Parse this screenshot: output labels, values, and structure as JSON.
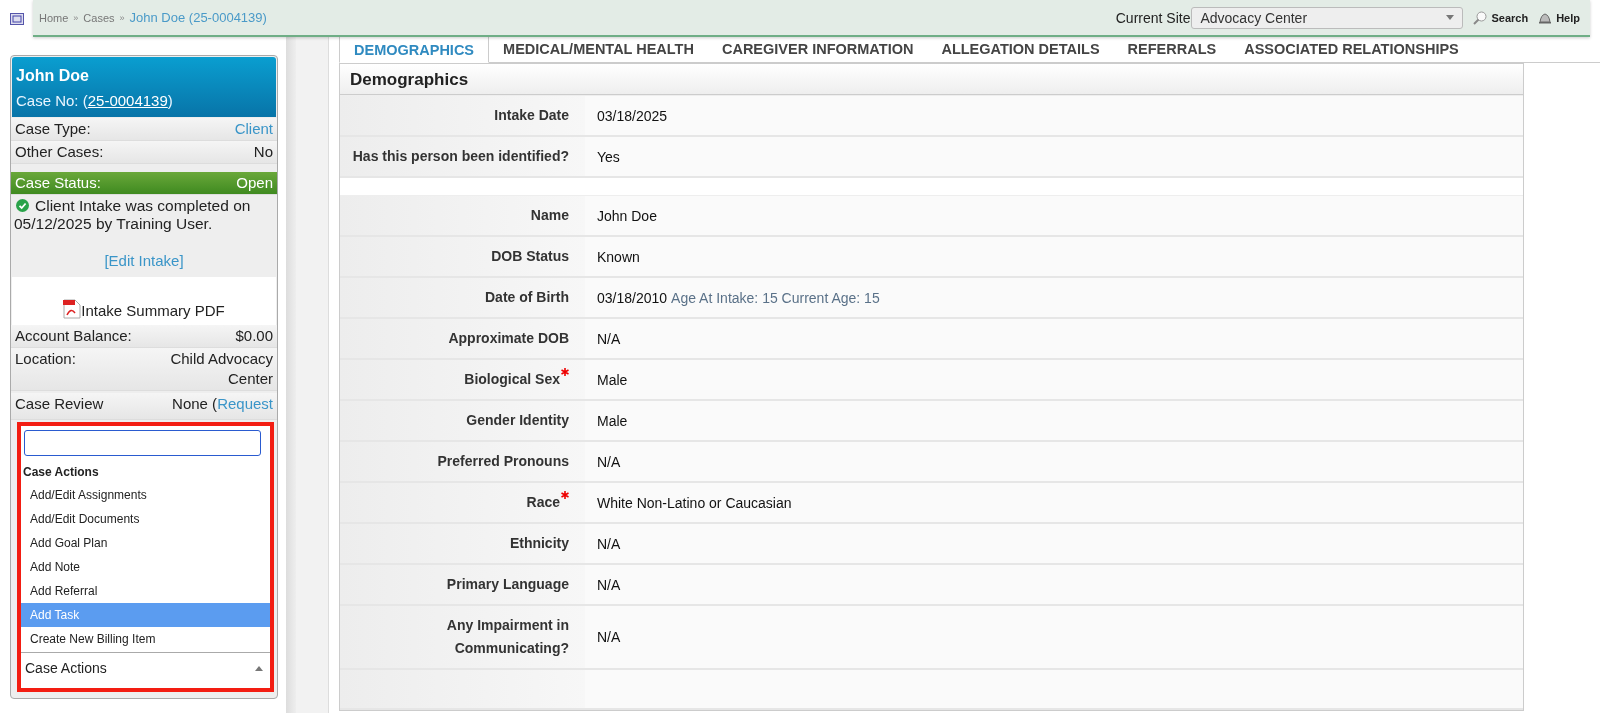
{
  "topbar": {
    "breadcrumbs": [
      {
        "label": "Home",
        "current": false
      },
      {
        "label": "Cases",
        "current": false
      },
      {
        "label": "John Doe (25-0004139)",
        "current": true
      }
    ],
    "separator": "»",
    "site_label": "Current Site",
    "site_value": "Advocacy Center",
    "search_label": "Search",
    "help_label": "Help"
  },
  "sidebar": {
    "name": "John Doe",
    "case_no_prefix": "Case No: (",
    "case_no": "25-0004139",
    "case_no_suffix": ")",
    "rows": [
      {
        "kind": "plain",
        "label": "Case Type:",
        "value": "Client",
        "link": true
      },
      {
        "kind": "plain",
        "label": "Other Cases:",
        "value": "No",
        "link": false
      },
      {
        "kind": "status",
        "label": "Case Status:",
        "value": "Open",
        "link": false
      }
    ],
    "intake_message": "Client Intake was completed on 05/12/2025 by Training User.",
    "edit_intake": "[Edit Intake]",
    "pdf_link": "Intake Summary PDF",
    "rows2": [
      {
        "label": "Account Balance:",
        "value": "$0.00"
      },
      {
        "label": "Location:",
        "value": "Child Advocacy Center"
      }
    ],
    "case_review": {
      "label": "Case Review",
      "value": "None (",
      "link": "Request"
    }
  },
  "dropdown": {
    "group": "Case Actions",
    "items": [
      {
        "label": "Add/Edit Assignments",
        "selected": false
      },
      {
        "label": "Add/Edit Documents",
        "selected": false
      },
      {
        "label": "Add Goal Plan",
        "selected": false
      },
      {
        "label": "Add Note",
        "selected": false
      },
      {
        "label": "Add Referral",
        "selected": false
      },
      {
        "label": "Add Task",
        "selected": true
      },
      {
        "label": "Create New Billing Item",
        "selected": false
      }
    ],
    "value": "Case Actions"
  },
  "tabs": [
    {
      "label": "DEMOGRAPHICS",
      "selected": true
    },
    {
      "label": "MEDICAL/MENTAL HEALTH",
      "selected": false
    },
    {
      "label": "CAREGIVER INFORMATION",
      "selected": false
    },
    {
      "label": "ALLEGATION DETAILS",
      "selected": false
    },
    {
      "label": "REFERRALS",
      "selected": false
    },
    {
      "label": "ASSOCIATED RELATIONSHIPS",
      "selected": false
    }
  ],
  "section": {
    "title": "Demographics",
    "groups": [
      [
        {
          "label": "Intake Date",
          "value": "03/18/2025",
          "required": false
        },
        {
          "label": "Has this person been identified?",
          "value": "Yes",
          "required": false
        }
      ],
      [
        {
          "label": "Name",
          "value": "John Doe",
          "required": false
        },
        {
          "label": "DOB Status",
          "value": "Known",
          "required": false
        },
        {
          "label": "Date of Birth",
          "value": "03/18/2010",
          "note": "Age At Intake: 15 Current Age: 15",
          "required": false
        },
        {
          "label": "Approximate DOB",
          "value": "N/A",
          "required": false
        },
        {
          "label": "Biological Sex",
          "value": "Male",
          "required": true
        },
        {
          "label": "Gender Identity",
          "value": "Male",
          "required": false
        },
        {
          "label": "Preferred Pronouns",
          "value": "N/A",
          "required": false
        },
        {
          "label": "Race",
          "value": "White Non-Latino or Caucasian",
          "required": true
        },
        {
          "label": "Ethnicity",
          "value": "N/A",
          "required": false
        },
        {
          "label": "Primary Language",
          "value": "N/A",
          "required": false
        },
        {
          "label": "Any Impairment in Communicating?",
          "value": "N/A",
          "required": false
        }
      ]
    ]
  }
}
